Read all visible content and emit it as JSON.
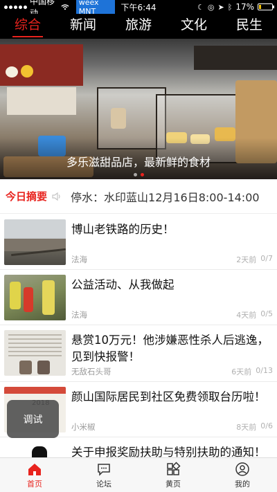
{
  "status_bar": {
    "carrier": "中国移动",
    "vpn": "weex MNT",
    "time": "下午6:44",
    "battery_percent": "17%",
    "battery_level": 0.17
  },
  "tabs": [
    {
      "label": "综合",
      "active": true
    },
    {
      "label": "新闻",
      "active": false
    },
    {
      "label": "旅游",
      "active": false
    },
    {
      "label": "文化",
      "active": false
    },
    {
      "label": "民生",
      "active": false
    }
  ],
  "banner": {
    "caption": "多乐滋甜品店，最新鲜的食材",
    "active_dot": 1,
    "dot_count": 2
  },
  "notice": {
    "label": "今日摘要",
    "text": "停水：水印蓝山12月16日8:00-14:00"
  },
  "news": [
    {
      "title": "博山老铁路的历史！",
      "source": "法海",
      "time": "2天前",
      "count": "0/7"
    },
    {
      "title": "公益活动、从我做起",
      "source": "法海",
      "time": "4天前",
      "count": "0/5"
    },
    {
      "title": "悬赏10万元！他涉嫌恶性杀人后逃逸，见到快报警！",
      "source": "无敌石头哥",
      "time": "6天前",
      "count": "0/13"
    },
    {
      "title": "颜山国际居民到社区免费领取台历啦！",
      "source": "小米椒",
      "time": "8天前",
      "count": "0/6"
    },
    {
      "title": "关于申报奖励扶助与特别扶助的通知！",
      "source": "",
      "time": "",
      "count": ""
    }
  ],
  "thumb_texts": {
    "calendar_year": "2018"
  },
  "debug_button": "调试",
  "bottom_nav": [
    {
      "label": "首页",
      "icon": "home-icon",
      "active": true
    },
    {
      "label": "论坛",
      "icon": "forum-icon",
      "active": false
    },
    {
      "label": "黄页",
      "icon": "grid-icon",
      "active": false
    },
    {
      "label": "我的",
      "icon": "profile-icon",
      "active": false
    }
  ],
  "colors": {
    "accent": "#e8231e",
    "status_bg": "#000000"
  }
}
